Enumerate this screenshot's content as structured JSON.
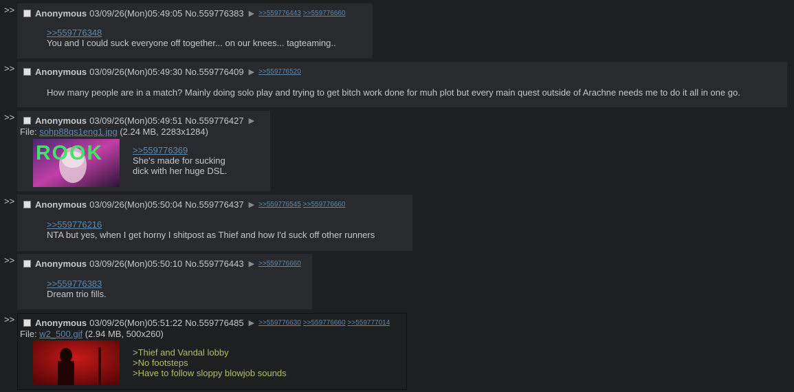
{
  "arrow": ">>",
  "menu_glyph": "▶",
  "posts": [
    {
      "name": "Anonymous",
      "date": "03/09/26(Mon)05:49:05",
      "number": "No.559776383",
      "backlinks": [
        ">>559776443",
        ">>559776660"
      ],
      "quote": ">>559776348",
      "text": "You and I could suck everyone off together... on our knees... tagteaming.."
    },
    {
      "name": "Anonymous",
      "date": "03/09/26(Mon)05:49:30",
      "number": "No.559776409",
      "backlinks": [
        ">>559776520"
      ],
      "text": "How many people are in a match? Mainly doing solo play and trying to get bitch work done for muh plot but every main quest outside of Arachne needs me to do it all in one go."
    },
    {
      "name": "Anonymous",
      "date": "03/09/26(Mon)05:49:51",
      "number": "No.559776427",
      "file_label": "File:",
      "file_name": "sohp88qs1eng1.jpg",
      "file_meta": "(2.24 MB, 2283x1284)",
      "thumb_text": "ROOK",
      "quote": ">>559776369",
      "text_line1": "She's made for sucking",
      "text_line2": "dick with her huge DSL."
    },
    {
      "name": "Anonymous",
      "date": "03/09/26(Mon)05:50:04",
      "number": "No.559776437",
      "backlinks": [
        ">>559776545",
        ">>559776660"
      ],
      "quote": ">>559776216",
      "text": "NTA but yes, when I get horny I shitpost as Thief and how I'd suck off other runners"
    },
    {
      "name": "Anonymous",
      "date": "03/09/26(Mon)05:50:10",
      "number": "No.559776443",
      "backlinks": [
        ">>559776660"
      ],
      "quote": ">>559776383",
      "text": "Dream trio fills."
    },
    {
      "name": "Anonymous",
      "date": "03/09/26(Mon)05:51:22",
      "number": "No.559776485",
      "backlinks": [
        ">>559776630",
        ">>559776660",
        ">>559777014"
      ],
      "file_label": "File:",
      "file_name": "w2_500.gif",
      "file_meta": "(2.94 MB, 500x260)",
      "green_lines": [
        ">Thief and Vandal lobby",
        ">No footsteps",
        ">Have to follow sloppy blowjob sounds"
      ]
    }
  ]
}
